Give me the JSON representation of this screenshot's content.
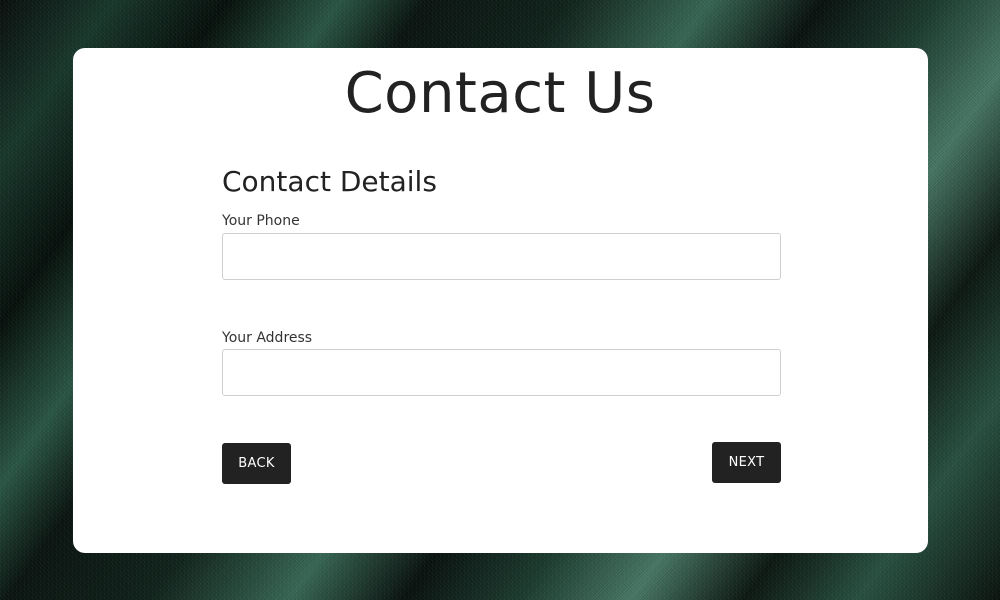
{
  "page": {
    "title": "Contact Us"
  },
  "form": {
    "section_title": "Contact Details",
    "fields": [
      {
        "label": "Your Phone",
        "value": "",
        "placeholder": ""
      },
      {
        "label": "Your Address",
        "value": "",
        "placeholder": ""
      }
    ]
  },
  "actions": {
    "back_label": "BACK",
    "next_label": "NEXT"
  },
  "colors": {
    "card_background": "#ffffff",
    "button_background": "#222222",
    "button_text": "#ffffff",
    "text_primary": "#222222",
    "input_border": "#cfcfcf",
    "backdrop_accent": "#3a6b58"
  }
}
